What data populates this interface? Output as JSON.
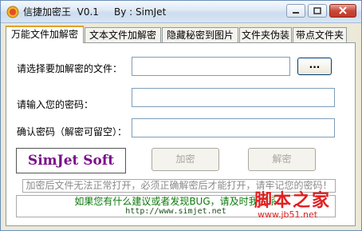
{
  "window": {
    "title": "信捷加密王  V0.1     By : SimJet"
  },
  "tabs": [
    {
      "label": "万能文件加解密",
      "active": true
    },
    {
      "label": "文本文件加解密",
      "active": false
    },
    {
      "label": "隐藏秘密到图片",
      "active": false
    },
    {
      "label": "文件夹伪装",
      "active": false
    },
    {
      "label": "带点文件夹",
      "active": false
    }
  ],
  "form": {
    "file_label": "请选择要加解密的文件：",
    "file_value": "",
    "browse_label": "...",
    "password_label": "请输入您的密码：",
    "password_value": "",
    "confirm_label": "确认密码（解密可留空）：",
    "confirm_value": ""
  },
  "brand": {
    "logo_text": "SimJet Soft"
  },
  "actions": {
    "encrypt_label": "加密",
    "decrypt_label": "解密",
    "enabled": false
  },
  "notice": "加密后文件无法正常打开，必须正确解密后才能打开，请牢记您的密码！",
  "contact": {
    "line1": "如果您有什么建议或者发现BUG，请及时我联系",
    "url": "http://www.simjet.net"
  },
  "watermark": {
    "title": "脚本之家",
    "url": "www.jb51.net"
  },
  "colors": {
    "accent_tab": "#e0a22b",
    "logo": "#7a0f8a",
    "contact_text": "#0a7a0a",
    "watermark": "#e02020"
  }
}
